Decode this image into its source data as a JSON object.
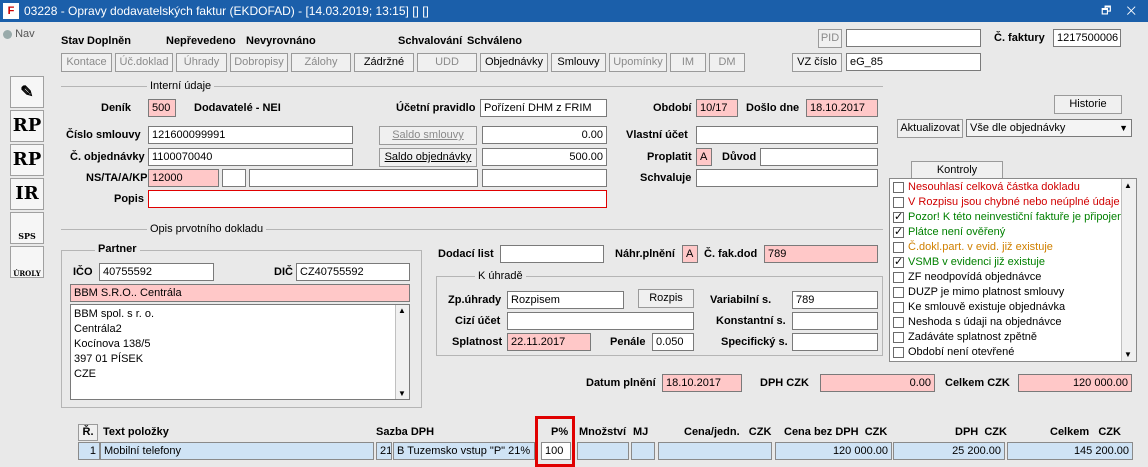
{
  "window": {
    "title": "03228 - Opravy dodavatelských faktur (EKDOFAD) - [14.03.2019; 13:15] [] []",
    "controls": "🗗 ✕"
  },
  "nav": {
    "label": "Nav"
  },
  "status": {
    "stav_label": "Stav",
    "stav_value": "Doplněn",
    "neprevedeno": "Nepřevedeno",
    "nevyrovnano": "Nevyrovnáno",
    "schvalovani_label": "Schvalování",
    "schvalovani_value": "Schváleno"
  },
  "toolbar": [
    "Kontace",
    "Úč.doklad",
    "Úhrady",
    "Dobropisy",
    "Zálohy",
    "Zádržné",
    "UDD",
    "Objednávky",
    "Smlouvy",
    "Upomínky",
    "IM",
    "DM"
  ],
  "header_right": {
    "pid_label": "PID",
    "pid_value": "",
    "faktura_label": "Č. faktury",
    "faktura_value": "1217500006",
    "vz_label": "VZ číslo",
    "vz_value": "eG_85"
  },
  "interni": {
    "section_label": "Interní údaje",
    "denik_label": "Deník",
    "denik_value": "500",
    "denik_text": "Dodavatelé - NEI",
    "ucetni_label": "Účetní pravidlo",
    "ucetni_value": "Pořízení DHM z FRIM",
    "obdobi_label": "Období",
    "obdobi_value": "10/17",
    "doslo_label": "Došlo dne",
    "doslo_value": "18.10.2017",
    "historie": "Historie",
    "aktualizovat": "Aktualizovat",
    "aktualizovat_select": "Vše dle objednávky",
    "smlouva_label": "Číslo smlouvy",
    "smlouva_value": "121600099991",
    "saldo_smlouvy_btn": "Saldo smlouvy",
    "saldo_smlouvy_value": "0.00",
    "vlastni_ucet_label": "Vlastní účet",
    "vlastni_ucet_value": "",
    "objednavka_label": "Č. objednávky",
    "objednavka_value": "1100070040",
    "saldo_obj_btn": "Saldo objednávky",
    "saldo_obj_value": "500.00",
    "proplatit_label": "Proplatit",
    "proplatit_value": "A",
    "duvod_label": "Důvod",
    "duvod_value": "",
    "ns_label": "NS/TA/A/KP",
    "ns_value": "12000",
    "schvaluje_label": "Schvaluje",
    "schvaluje_value": "",
    "popis_label": "Popis",
    "popis_value": ""
  },
  "kontroly": {
    "button": "Kontroly",
    "items": [
      {
        "text": "Nesouhlasí celková částka dokladu",
        "checked": false,
        "color": "#d00000"
      },
      {
        "text": "V Rozpisu jsou chybné nebo neúplné údaje",
        "checked": false,
        "color": "#d00000"
      },
      {
        "text": "Pozor! K této neinvestiční faktuře je připojen",
        "checked": true,
        "color": "#008000"
      },
      {
        "text": "Plátce není ověřený",
        "checked": true,
        "color": "#008000"
      },
      {
        "text": "Č.dokl.part. v evid. již existuje",
        "checked": false,
        "color": "#d08000"
      },
      {
        "text": "VSMB v evidenci již existuje",
        "checked": true,
        "color": "#008000"
      },
      {
        "text": "ZF neodpovídá objednávce",
        "checked": false,
        "color": "#000000"
      },
      {
        "text": "DUZP je mimo platnost smlouvy",
        "checked": false,
        "color": "#000000"
      },
      {
        "text": "Ke smlouvě existuje objednávka",
        "checked": false,
        "color": "#000000"
      },
      {
        "text": "Neshoda s údaji na objednávce",
        "checked": false,
        "color": "#000000"
      },
      {
        "text": "Zadáváte splatnost zpětně",
        "checked": false,
        "color": "#000000"
      },
      {
        "text": "Období není otevřené",
        "checked": false,
        "color": "#000000"
      }
    ]
  },
  "opis": {
    "section_label": "Opis prvotního dokladu",
    "partner_label": "Partner",
    "ico_label": "IČO",
    "ico_value": "40755592",
    "dic_label": "DIČ",
    "dic_value": "CZ40755592",
    "partner_name": "BBM S.R.O.. Centrála",
    "address": [
      "BBM spol. s r. o.",
      "Centrála2",
      "Kocínova 138/5",
      "397 01 PÍSEK",
      "CZE"
    ],
    "dodaci_label": "Dodací list",
    "dodaci_value": "",
    "nahr_label": "Náhr.plnění",
    "nahr_value": "A",
    "cfak_label": "Č. fak.dod",
    "cfak_value": "789"
  },
  "kuhrade": {
    "label": "K úhradě",
    "zp_label": "Zp.úhrady",
    "zp_value": "Rozpisem",
    "rozpis_btn": "Rozpis",
    "variabilni_label": "Variabilní s.",
    "variabilni_value": "789",
    "cizi_label": "Cizí účet",
    "cizi_value": "",
    "konstantni_label": "Konstantní s.",
    "konstantni_value": "",
    "splatnost_label": "Splatnost",
    "splatnost_value": "22.11.2017",
    "penale_label": "Penále",
    "penale_value": "0.050",
    "specificky_label": "Specifický s.",
    "specificky_value": ""
  },
  "totals": {
    "datum_label": "Datum plnění",
    "datum_value": "18.10.2017",
    "dph_label": "DPH",
    "dph_currency": "CZK",
    "dph_value": "0.00",
    "celkem_label": "Celkem",
    "celkem_currency": "CZK",
    "celkem_value": "120 000.00"
  },
  "table": {
    "headers": {
      "r": "Ř.",
      "text": "Text položky",
      "sazba": "Sazba DPH",
      "p": "P%",
      "mnozstvi": "Množství",
      "mj": "MJ",
      "cena": "Cena/jedn.",
      "cena_cur": "CZK",
      "bez": "Cena bez DPH",
      "bez_cur": "CZK",
      "dph": "DPH",
      "dph_cur": "CZK",
      "celkem": "Celkem",
      "celkem_cur": "CZK"
    },
    "row1": {
      "r": "1",
      "text": "Mobilní telefony",
      "sazba_num": "21",
      "sazba_text": "B  Tuzemsko vstup \"P\" 21%",
      "p": "100",
      "mnozstvi": "",
      "mj": "",
      "cena": "",
      "bez": "120 000.00",
      "dph": "25 200.00",
      "celkem": "145 200.00"
    }
  },
  "sidebar": {
    "icons": [
      "edit-icon",
      "rp-cz-icon",
      "rp-eu-icon",
      "ir-cz-icon",
      "sps-icon",
      "uroly-icon"
    ],
    "labels": [
      "",
      "RP",
      "RP",
      "IR",
      "SPS",
      "ÚROLY"
    ]
  }
}
